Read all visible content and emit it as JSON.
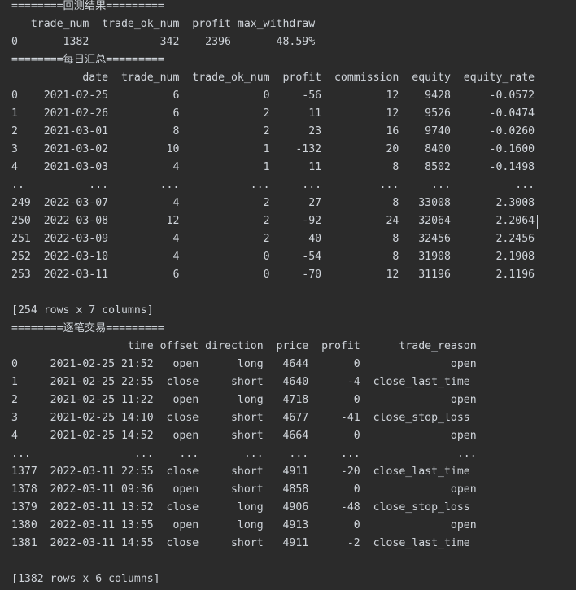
{
  "console": {
    "lines": [
      "========回测结果=========",
      "   trade_num  trade_ok_num  profit max_withdraw",
      "0       1382           342    2396       48.59%",
      "========每日汇总=========",
      "           date  trade_num  trade_ok_num  profit  commission  equity  equity_rate",
      "0    2021-02-25          6             0     -56          12    9428      -0.0572",
      "1    2021-02-26          6             2      11          12    9526      -0.0474",
      "2    2021-03-01          8             2      23          16    9740      -0.0260",
      "3    2021-03-02         10             1    -132          20    8400      -0.1600",
      "4    2021-03-03          4             1      11           8    8502      -0.1498",
      "..          ...        ...           ...     ...         ...     ...          ...",
      "249  2022-03-07          4             2      27           8   33008       2.3008",
      "250  2022-03-08         12             2     -92          24   32064       2.2064",
      "251  2022-03-09          4             2      40           8   32456       2.2456",
      "252  2022-03-10          4             0     -54           8   31908       2.1908",
      "253  2022-03-11          6             0     -70          12   31196       2.1196",
      "",
      "[254 rows x 7 columns]",
      "========逐笔交易=========",
      "                  time offset direction  price  profit      trade_reason",
      "0     2021-02-25 21:52   open      long   4644       0              open",
      "1     2021-02-25 22:55  close     short   4640      -4  close_last_time",
      "2     2021-02-25 11:22   open      long   4718       0              open",
      "3     2021-02-25 14:10  close     short   4677     -41  close_stop_loss",
      "4     2021-02-25 14:52   open     short   4664       0              open",
      "...                ...    ...       ...    ...     ...               ...",
      "1377  2022-03-11 22:55  close     short   4911     -20  close_last_time",
      "1378  2022-03-11 09:36   open     short   4858       0              open",
      "1379  2022-03-11 13:52  close      long   4906     -48  close_stop_loss",
      "1380  2022-03-11 13:55   open      long   4913       0              open",
      "1381  2022-03-11 14:55  close     short   4911      -2  close_last_time",
      "",
      "[1382 rows x 6 columns]"
    ]
  },
  "colors": {
    "background": "#2b2b2b",
    "text": "#cfd4da"
  }
}
